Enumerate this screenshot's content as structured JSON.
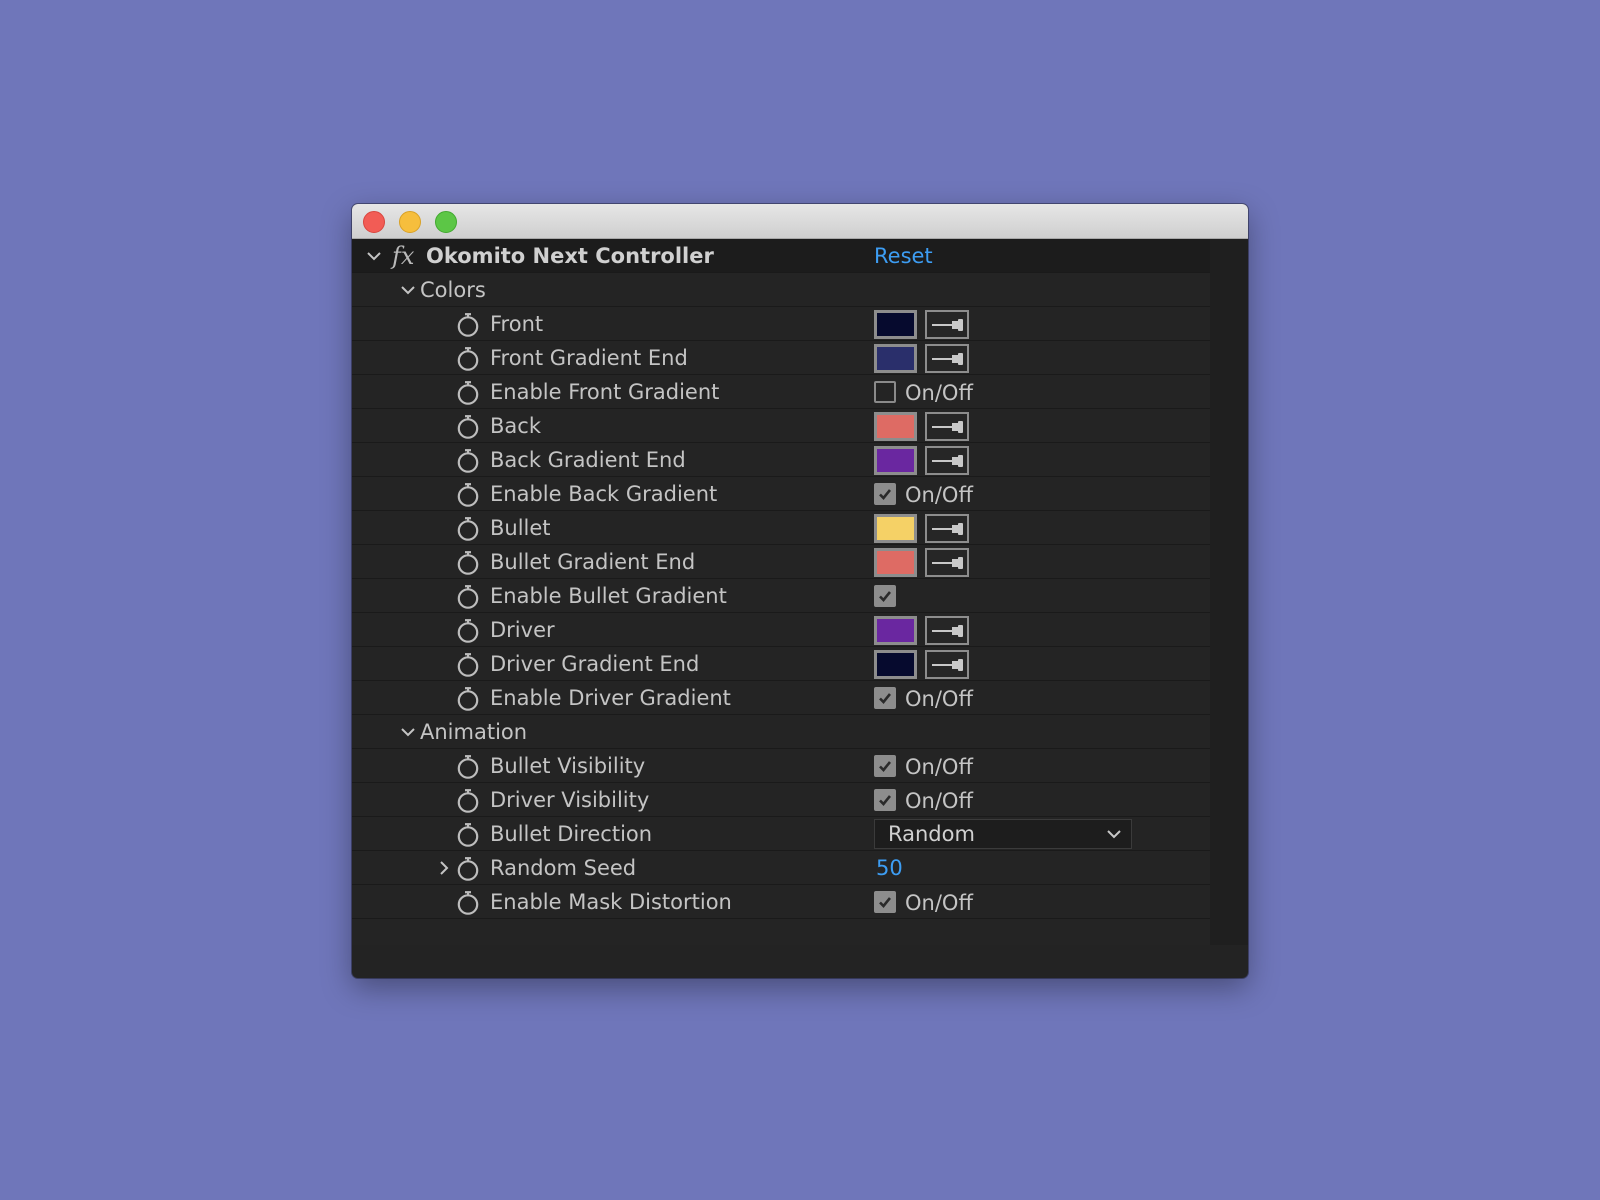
{
  "window": {
    "controls": [
      "close",
      "minimize",
      "maximize"
    ]
  },
  "effect": {
    "fx_symbol": "fx",
    "title": "Okomito Next Controller",
    "reset_label": "Reset"
  },
  "groups": {
    "colors": {
      "label": "Colors"
    },
    "animation": {
      "label": "Animation"
    }
  },
  "colors_rows": [
    {
      "label": "Front",
      "type": "color",
      "color": "#060a2e"
    },
    {
      "label": "Front Gradient End",
      "type": "color",
      "color": "#2a2f6b"
    },
    {
      "label": "Enable Front Gradient",
      "type": "checkbox",
      "checked": false,
      "text": "On/Off"
    },
    {
      "label": "Back",
      "type": "color",
      "color": "#de6b64"
    },
    {
      "label": "Back Gradient End",
      "type": "color",
      "color": "#6a27a0"
    },
    {
      "label": "Enable Back Gradient",
      "type": "checkbox",
      "checked": true,
      "text": "On/Off"
    },
    {
      "label": "Bullet",
      "type": "color",
      "color": "#f5d166"
    },
    {
      "label": "Bullet Gradient End",
      "type": "color",
      "color": "#de6b64"
    },
    {
      "label": "Enable Bullet Gradient",
      "type": "checkbox",
      "checked": true,
      "text": ""
    },
    {
      "label": "Driver",
      "type": "color",
      "color": "#6a27a0"
    },
    {
      "label": "Driver Gradient End",
      "type": "color",
      "color": "#060a2e"
    },
    {
      "label": "Enable Driver Gradient",
      "type": "checkbox",
      "checked": true,
      "text": "On/Off"
    }
  ],
  "animation_rows": [
    {
      "label": "Bullet Visibility",
      "type": "checkbox",
      "checked": true,
      "text": "On/Off"
    },
    {
      "label": "Driver Visibility",
      "type": "checkbox",
      "checked": true,
      "text": "On/Off"
    },
    {
      "label": "Bullet Direction",
      "type": "dropdown",
      "value": "Random"
    },
    {
      "label": "Random Seed",
      "type": "value",
      "value": "50",
      "expandable": true
    },
    {
      "label": "Enable Mask Distortion",
      "type": "checkbox",
      "checked": true,
      "text": "On/Off"
    }
  ],
  "theme": {
    "accent": "#3d9df3",
    "panel_bg": "#242424",
    "desktop_bg": "#6f76ba"
  }
}
